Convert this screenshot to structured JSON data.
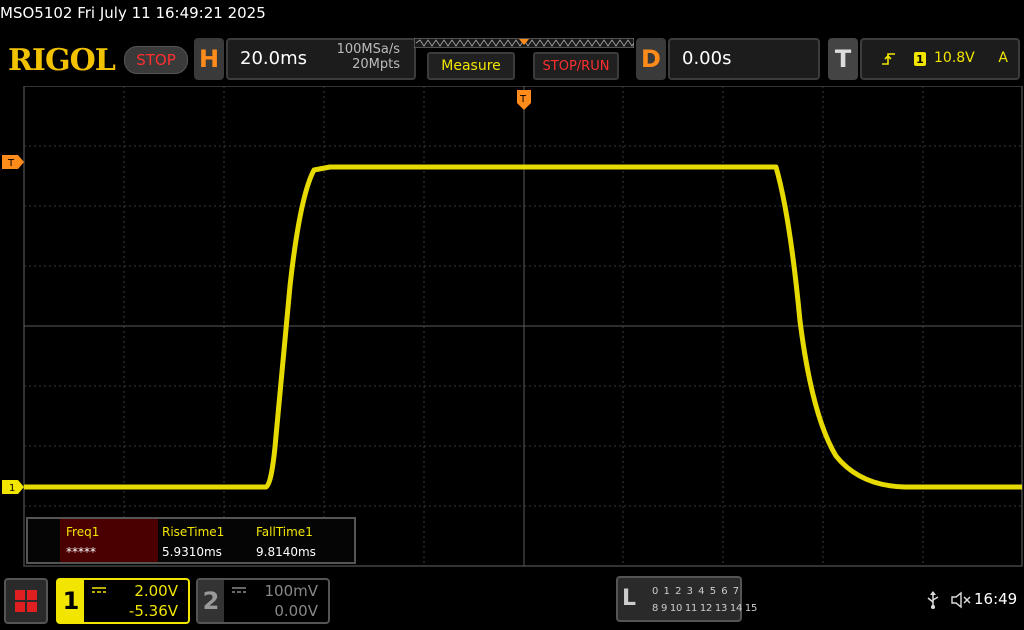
{
  "title_bar": {
    "text": "MSO5102  Fri July 11 16:49:21 2025"
  },
  "brand": "RIGOL",
  "run_state": "STOP",
  "horizontal": {
    "letter": "H",
    "timebase": "20.0ms",
    "sample_rate": "100MSa/s",
    "memory_depth": "20Mpts"
  },
  "buttons": {
    "measure": "Measure",
    "stop_run": "STOP/RUN"
  },
  "delay": {
    "letter": "D",
    "value": "0.00s"
  },
  "trigger": {
    "letter": "T",
    "source_channel": "1",
    "level": "10.8V",
    "mode": "A",
    "slope_icon": "rising-edge-icon"
  },
  "markers": {
    "trigger_level": "T",
    "channel1_ground": "1",
    "trigger_position": "T"
  },
  "measurements": [
    {
      "name": "Freq1",
      "value": "*****"
    },
    {
      "name": "RiseTime1",
      "value": "5.9310ms"
    },
    {
      "name": "FallTime1",
      "value": "9.8140ms"
    }
  ],
  "channels": [
    {
      "number": "1",
      "scale": "2.00V",
      "offset": "-5.36V",
      "color": "#f2e600",
      "coupling_icon": "dc-coupling-icon"
    },
    {
      "number": "2",
      "scale": "100mV",
      "offset": "0.00V",
      "color": "#888888",
      "coupling_icon": "dc-coupling-icon"
    }
  ],
  "logic_analyzer": {
    "letter": "L",
    "row1": "0 1 2 3   4 5 6 7",
    "row2": "8 9 10 11 12 13 14 15"
  },
  "status": {
    "time": "16:49"
  },
  "colors": {
    "channel1": "#f2e600",
    "trigger": "#ff8c1a",
    "stop": "#ff2f2f",
    "brand": "#f2c200"
  }
}
